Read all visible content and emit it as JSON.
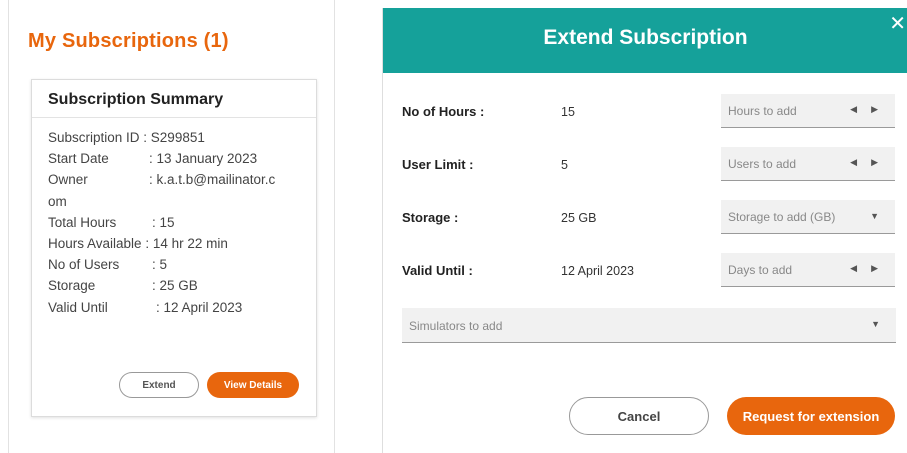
{
  "page": {
    "title": "My Subscriptions (1)"
  },
  "summary": {
    "title": "Subscription Summary",
    "rows": [
      {
        "label": "Subscription ID : ",
        "value": "S299851"
      },
      {
        "label": "Start Date      ",
        "value": ": 13 January 2023"
      },
      {
        "label": "Owner",
        "value": ": k.a.t.b@mailinator.c"
      },
      {
        "label": "om",
        "value": ""
      },
      {
        "label": "Total Hours      ",
        "value": ": 15"
      },
      {
        "label": "Hours Available ",
        "value": ": 14 hr 22 min"
      },
      {
        "label": "No of Users     ",
        "value": ": 5"
      },
      {
        "label": "Storage           ",
        "value": ": 25 GB"
      },
      {
        "label": "Valid Until       ",
        "value": ": 12 April 2023"
      }
    ],
    "extend_label": "Extend",
    "view_details_label": "View Details"
  },
  "modal": {
    "title": "Extend Subscription",
    "close": "✕",
    "fields": [
      {
        "label": "No of Hours :",
        "value": "15",
        "placeholder": "Hours to add"
      },
      {
        "label": "User Limit :",
        "value": "5",
        "placeholder": "Users to add"
      },
      {
        "label": "Storage :",
        "value": "25 GB",
        "placeholder": "Storage to add (GB)"
      },
      {
        "label": "Valid Until :",
        "value": "12 April 2023",
        "placeholder": "Days to add"
      }
    ],
    "simulators_placeholder": "Simulators to add",
    "cancel_label": "Cancel",
    "request_label": "Request for extension"
  },
  "icons": {
    "spin_left": "◀",
    "spin_right": "▶",
    "caret": "▼"
  },
  "colors": {
    "accent": "#e8660d",
    "header": "#15a19a"
  }
}
